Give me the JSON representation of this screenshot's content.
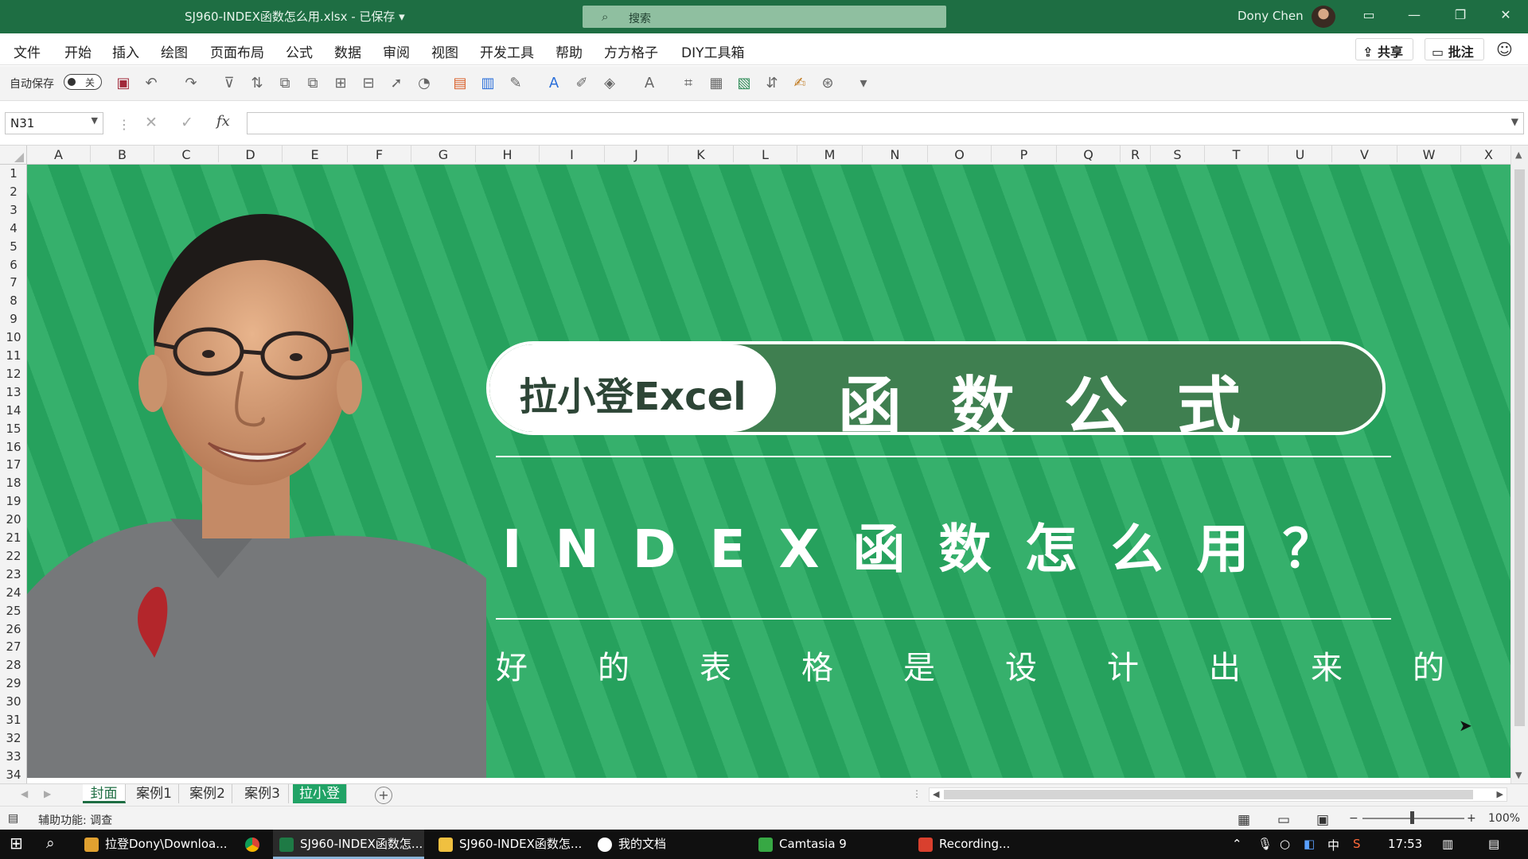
{
  "window": {
    "doc_title": "SJ960-INDEX函数怎么用.xlsx  -  已保存  ▾",
    "search_placeholder": "搜索",
    "user": "Dony Chen"
  },
  "menu": [
    "文件",
    "开始",
    "插入",
    "绘图",
    "页面布局",
    "公式",
    "数据",
    "审阅",
    "视图",
    "开发工具",
    "帮助",
    "方方格子",
    "DIY工具箱"
  ],
  "menu_right": {
    "share": "共享",
    "comment": "批注"
  },
  "qat": {
    "autosave_label": "自动保存",
    "toggle_state": "关"
  },
  "formula_bar": {
    "name_box": "N31",
    "fx": "fx",
    "formula": ""
  },
  "columns": [
    "A",
    "B",
    "C",
    "D",
    "E",
    "F",
    "G",
    "H",
    "I",
    "J",
    "K",
    "L",
    "M",
    "N",
    "O",
    "P",
    "Q",
    "R",
    "S",
    "T",
    "U",
    "V",
    "W",
    "X"
  ],
  "rows": [
    "1",
    "2",
    "3",
    "4",
    "5",
    "6",
    "7",
    "8",
    "9",
    "10",
    "11",
    "12",
    "13",
    "14",
    "15",
    "16",
    "17",
    "18",
    "19",
    "20",
    "21",
    "22",
    "23",
    "24",
    "25",
    "26",
    "27",
    "28",
    "29",
    "30",
    "31",
    "32",
    "33",
    "34"
  ],
  "banner": {
    "brand": "拉小登Excel",
    "headline": "函数公式",
    "subtitle": "INDEX函数怎么用？",
    "tagline": "好的表格是设计出来的"
  },
  "sheets": [
    {
      "label": "封面",
      "state": "active"
    },
    {
      "label": "案例1",
      "state": "normal"
    },
    {
      "label": "案例2",
      "state": "normal"
    },
    {
      "label": "案例3",
      "state": "normal"
    },
    {
      "label": "拉小登",
      "state": "green"
    }
  ],
  "status": {
    "accessibility": "辅助功能: 调查",
    "zoom": "100%"
  },
  "taskbar": {
    "items": [
      {
        "label": "拉登Dony\\Downloa...",
        "color": "#e0a030"
      },
      {
        "label": "SJ960-INDEX函数怎...",
        "color": "#1e7a45"
      },
      {
        "label": "SJ960-INDEX函数怎...",
        "color": "#f0c040"
      },
      {
        "label": "我的文档",
        "color": "#ffffff"
      },
      {
        "label": "Camtasia 9",
        "color": "#37a844"
      },
      {
        "label": "Recording...",
        "color": "#d9402e"
      }
    ],
    "ime": "中",
    "clock": "17:53"
  },
  "colors": {
    "excel_green": "#1e6e43",
    "banner_green": "#26a15d",
    "pill_green": "#3f7f50"
  }
}
